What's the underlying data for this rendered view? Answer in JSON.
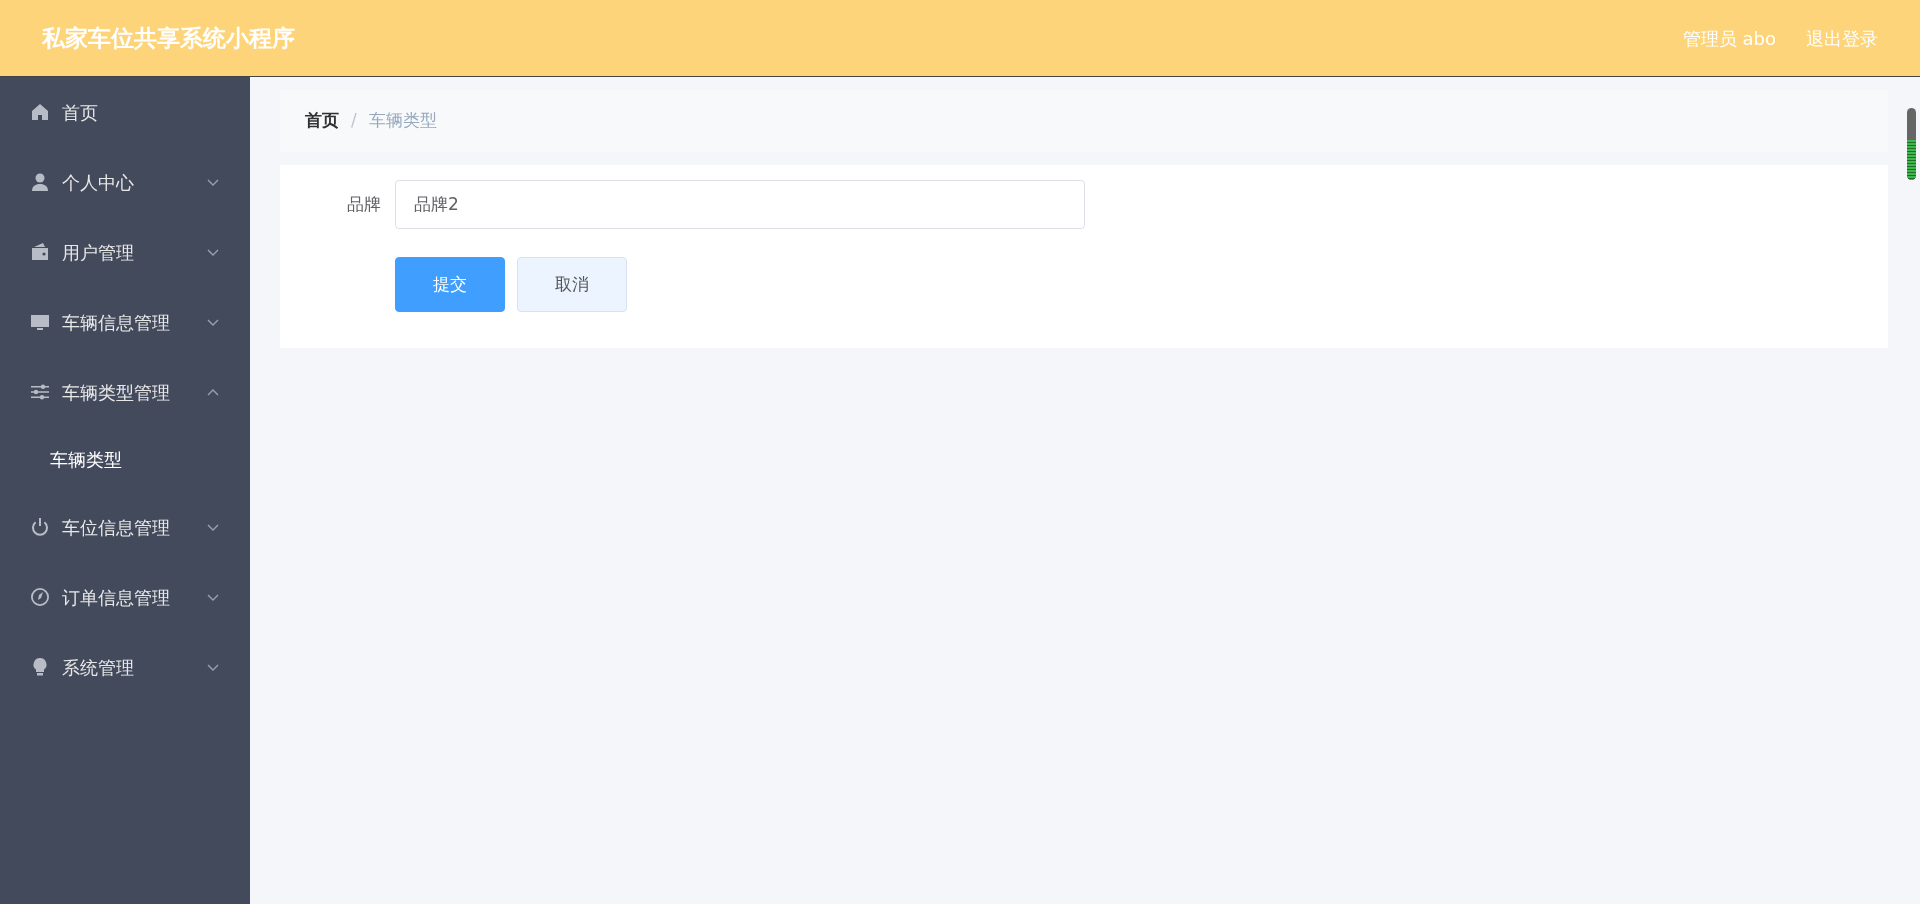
{
  "header": {
    "title": "私家车位共享系统小程序",
    "user": "管理员 abo",
    "logout": "退出登录"
  },
  "sidebar": {
    "items": [
      {
        "label": "首页"
      },
      {
        "label": "个人中心",
        "expanded": false
      },
      {
        "label": "用户管理",
        "expanded": false
      },
      {
        "label": "车辆信息管理",
        "expanded": false
      },
      {
        "label": "车辆类型管理",
        "expanded": true,
        "children": [
          {
            "label": "车辆类型",
            "selected": true
          }
        ]
      },
      {
        "label": "车位信息管理",
        "expanded": false
      },
      {
        "label": "订单信息管理",
        "expanded": false
      },
      {
        "label": "系统管理",
        "expanded": false
      }
    ]
  },
  "breadcrumb": {
    "items": [
      "首页",
      "车辆类型"
    ],
    "separator": "/"
  },
  "form": {
    "fields": [
      {
        "label": "品牌",
        "value": "品牌2"
      }
    ],
    "buttons": [
      {
        "label": "提交",
        "kind": "primary"
      },
      {
        "label": "取消",
        "kind": "secondary"
      }
    ]
  },
  "level_meter": {
    "level": 0.55
  }
}
